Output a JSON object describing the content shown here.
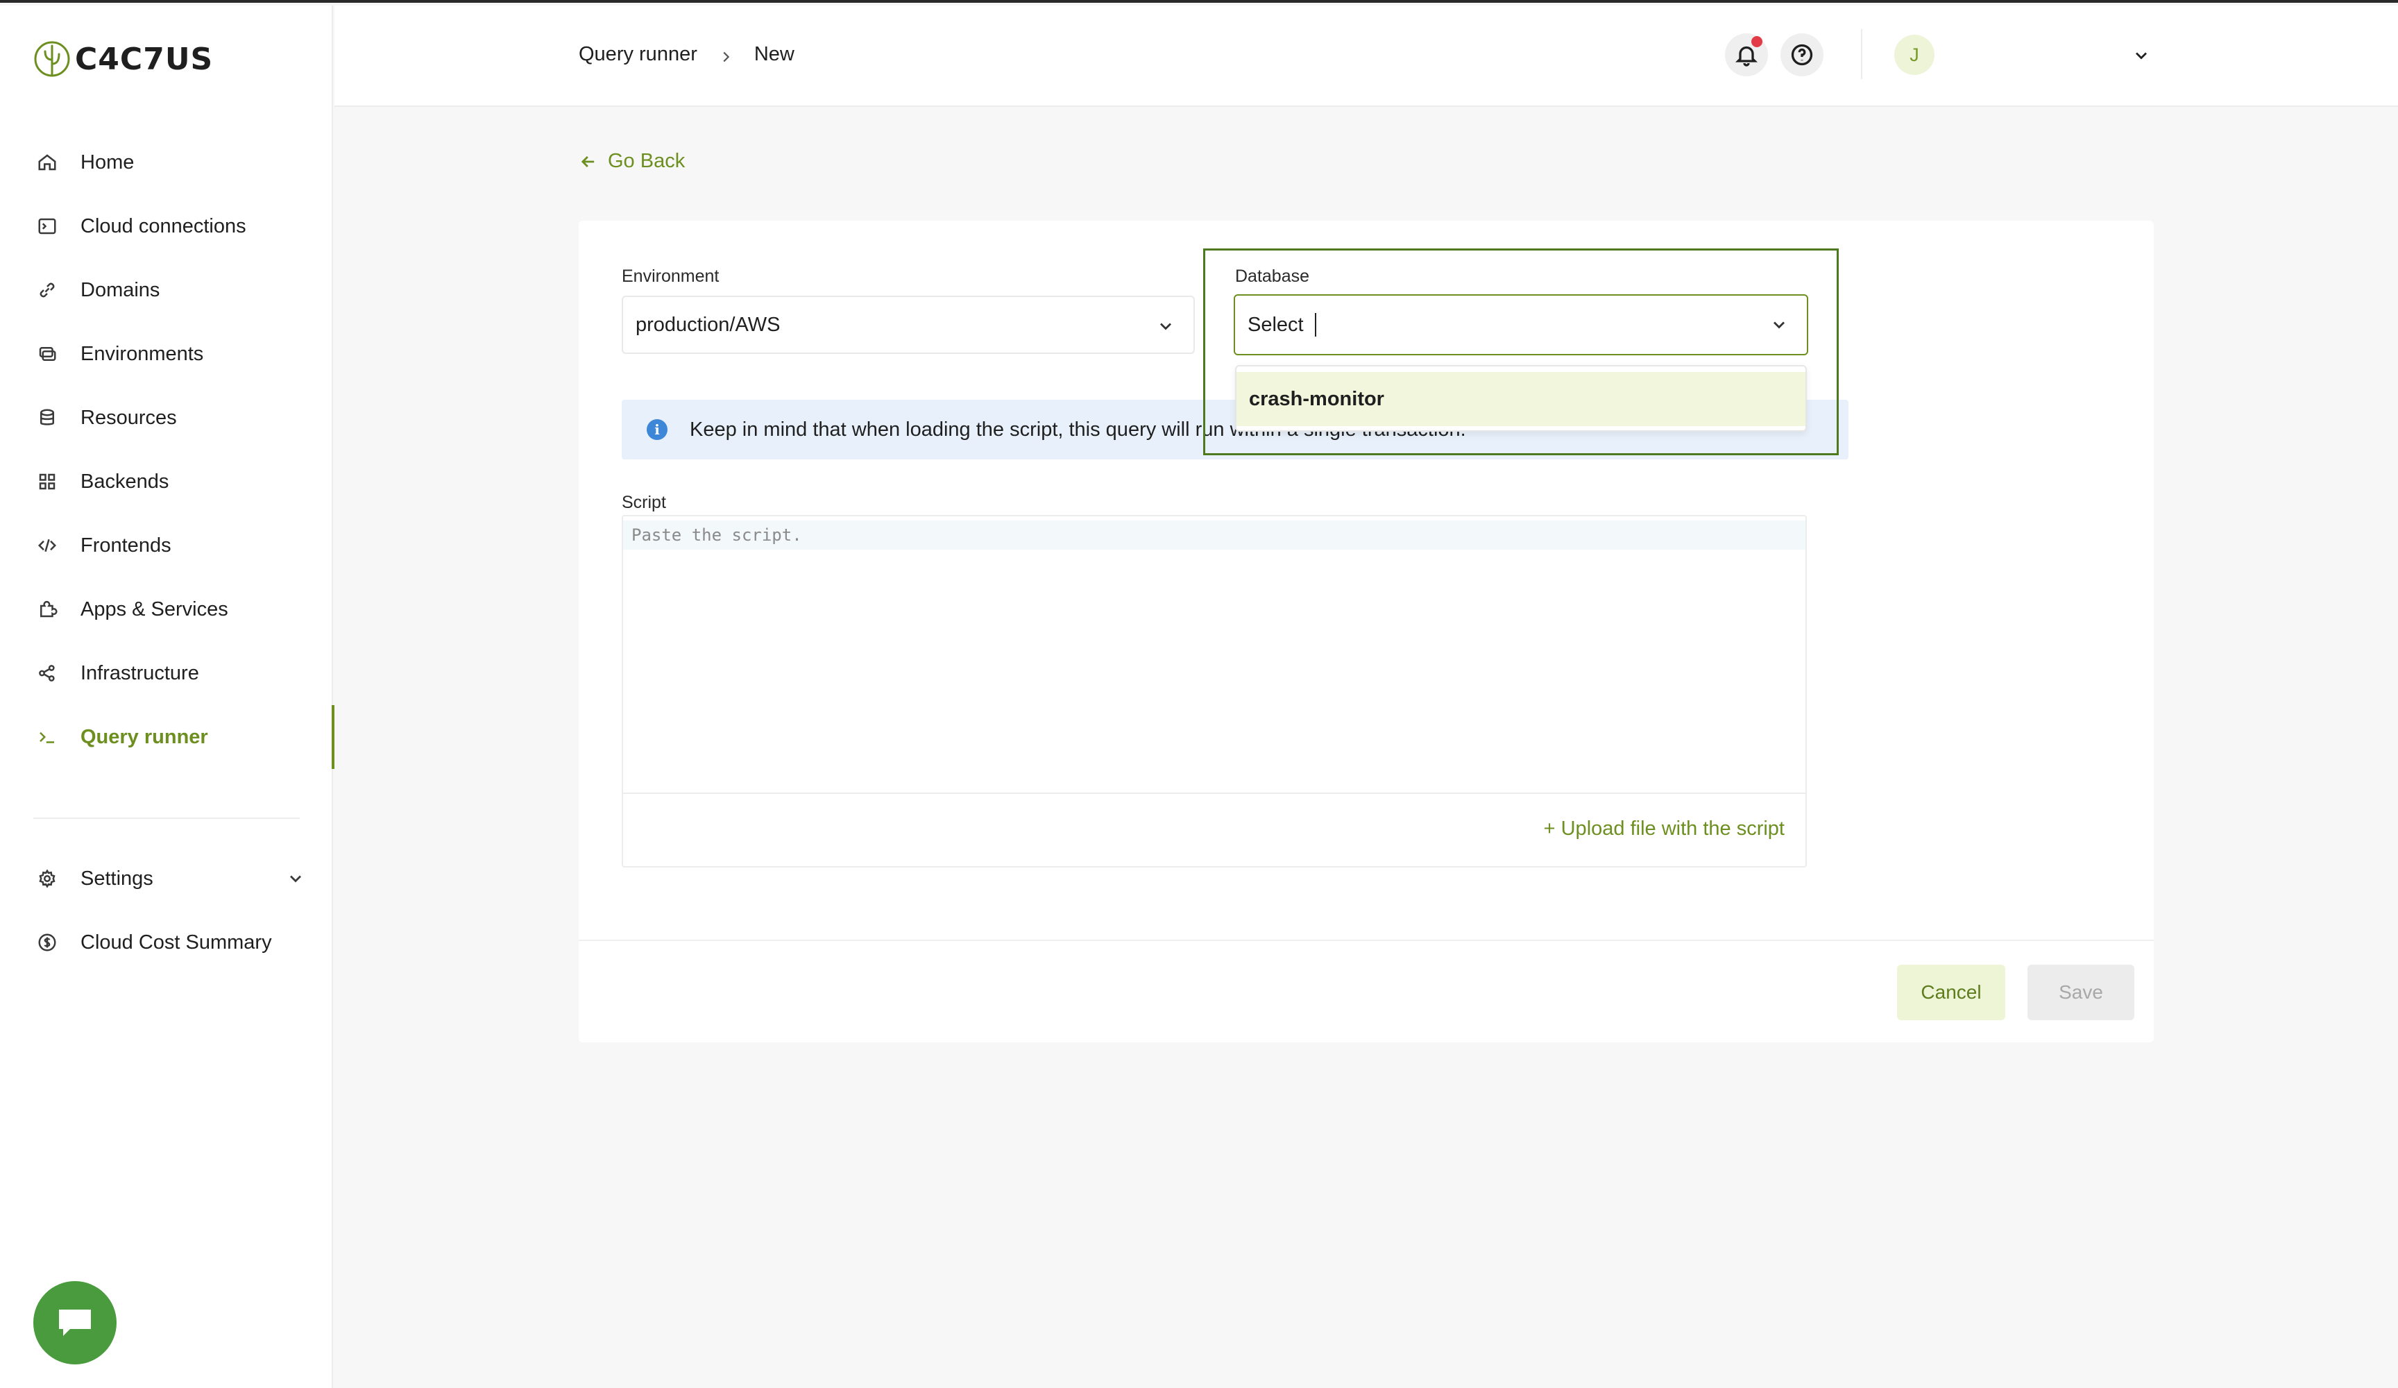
{
  "app": {
    "logo_text": "C4C7US"
  },
  "sidebar": {
    "items": [
      {
        "label": "Home",
        "icon": "home-icon"
      },
      {
        "label": "Cloud connections",
        "icon": "terminal-box-icon"
      },
      {
        "label": "Domains",
        "icon": "link-icon"
      },
      {
        "label": "Environments",
        "icon": "environments-icon"
      },
      {
        "label": "Resources",
        "icon": "database-icon"
      },
      {
        "label": "Backends",
        "icon": "grid-icon"
      },
      {
        "label": "Frontends",
        "icon": "code-icon"
      },
      {
        "label": "Apps & Services",
        "icon": "puzzle-icon"
      },
      {
        "label": "Infrastructure",
        "icon": "share-nodes-icon"
      },
      {
        "label": "Query runner",
        "icon": "prompt-icon",
        "active": true
      }
    ],
    "secondary": [
      {
        "label": "Settings",
        "icon": "gear-icon"
      },
      {
        "label": "Cloud Cost Summary",
        "icon": "dollar-circle-icon"
      }
    ]
  },
  "header": {
    "breadcrumb": [
      "Query runner",
      "New"
    ],
    "avatar_initial": "J"
  },
  "main": {
    "go_back": "Go Back",
    "environment": {
      "label": "Environment",
      "value": "production/AWS"
    },
    "database": {
      "label": "Database",
      "value": "Select",
      "options": [
        "crash-monitor"
      ]
    },
    "info_text": "Keep in mind that when loading the script, this query will run within a single transaction.",
    "script": {
      "label": "Script",
      "placeholder": "Paste the script.",
      "upload_label": "+ Upload file with the script"
    },
    "cancel_label": "Cancel",
    "save_label": "Save"
  },
  "colors": {
    "accent": "#6c8f1f",
    "info_bg": "#e8f1fb",
    "chat": "#4a9a3e"
  }
}
